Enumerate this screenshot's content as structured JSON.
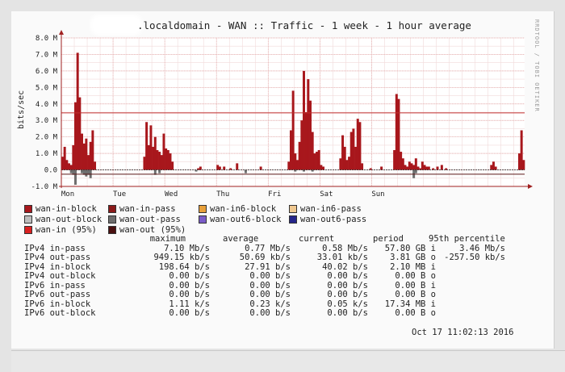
{
  "graph": {
    "title": ".localdomain - WAN :: Traffic - 1 week - 1 hour average",
    "credit": "RRDTOOL / TOBI OETIKER",
    "timestamp": "Oct 17 11:02:13 2016"
  },
  "colors": {
    "background": "#fafafa",
    "grid": "#e8b4b4",
    "in_block": "#a8171c",
    "percentile_line": "#c03030",
    "axis": "#a02020"
  },
  "chart_data": {
    "type": "bar",
    "title": ".localdomain - WAN :: Traffic - 1 week - 1 hour average",
    "ylabel": "bits/sec",
    "ylim": [
      -1000000,
      8000000
    ],
    "yticks": [
      {
        "value": 8000000,
        "label": "8.0 M"
      },
      {
        "value": 7000000,
        "label": "7.0 M"
      },
      {
        "value": 6000000,
        "label": "6.0 M"
      },
      {
        "value": 5000000,
        "label": "5.0 M"
      },
      {
        "value": 4000000,
        "label": "4.0 M"
      },
      {
        "value": 3000000,
        "label": "3.0 M"
      },
      {
        "value": 2000000,
        "label": "2.0 M"
      },
      {
        "value": 1000000,
        "label": "1.0 M"
      },
      {
        "value": 0,
        "label": "0.0"
      },
      {
        "value": -1000000,
        "label": "-1.0 M"
      }
    ],
    "xticks": [
      "Mon",
      "Tue",
      "Wed",
      "Thu",
      "Fri",
      "Sat",
      "Sun"
    ],
    "hours_total": 168,
    "percentile_lines": [
      {
        "name": "wan-in (95%)",
        "value": 3460000
      },
      {
        "name": "wan-out (95%)",
        "value": -257500
      }
    ],
    "series": [
      {
        "name": "wan-in-block",
        "points": [
          [
            0,
            0.8
          ],
          [
            1,
            1.4
          ],
          [
            2,
            0.6
          ],
          [
            3,
            0.4
          ],
          [
            4,
            0.3
          ],
          [
            5,
            1.5
          ],
          [
            6,
            4.1
          ],
          [
            7,
            7.1
          ],
          [
            8,
            4.4
          ],
          [
            9,
            2.2
          ],
          [
            10,
            1.6
          ],
          [
            11,
            1.9
          ],
          [
            12,
            0.9
          ],
          [
            13,
            1.7
          ],
          [
            14,
            2.4
          ],
          [
            15,
            0.5
          ],
          [
            38,
            0.8
          ],
          [
            39,
            2.9
          ],
          [
            40,
            1.5
          ],
          [
            41,
            2.7
          ],
          [
            42,
            1.4
          ],
          [
            43,
            2.0
          ],
          [
            44,
            1.2
          ],
          [
            45,
            1.1
          ],
          [
            46,
            0.9
          ],
          [
            47,
            2.2
          ],
          [
            48,
            1.3
          ],
          [
            49,
            1.2
          ],
          [
            50,
            1.0
          ],
          [
            51,
            0.5
          ],
          [
            63,
            0.1
          ],
          [
            64,
            0.2
          ],
          [
            72,
            0.3
          ],
          [
            73,
            0.2
          ],
          [
            75,
            0.2
          ],
          [
            78,
            0.1
          ],
          [
            81,
            0.4
          ],
          [
            92,
            0.2
          ],
          [
            105,
            0.5
          ],
          [
            106,
            2.4
          ],
          [
            107,
            4.8
          ],
          [
            108,
            1.0
          ],
          [
            109,
            0.6
          ],
          [
            110,
            1.7
          ],
          [
            111,
            3.0
          ],
          [
            112,
            6.0
          ],
          [
            113,
            3.5
          ],
          [
            114,
            5.5
          ],
          [
            115,
            4.2
          ],
          [
            116,
            2.3
          ],
          [
            117,
            1.0
          ],
          [
            118,
            1.1
          ],
          [
            119,
            1.2
          ],
          [
            120,
            0.3
          ],
          [
            121,
            0.2
          ],
          [
            129,
            0.7
          ],
          [
            130,
            2.1
          ],
          [
            131,
            1.4
          ],
          [
            132,
            0.6
          ],
          [
            133,
            0.8
          ],
          [
            134,
            2.3
          ],
          [
            135,
            2.5
          ],
          [
            136,
            1.4
          ],
          [
            137,
            3.1
          ],
          [
            138,
            2.9
          ],
          [
            139,
            0.4
          ],
          [
            143,
            0.1
          ],
          [
            148,
            0.2
          ],
          [
            154,
            1.2
          ],
          [
            155,
            4.6
          ],
          [
            156,
            4.3
          ],
          [
            157,
            1.1
          ],
          [
            158,
            0.7
          ],
          [
            159,
            0.3
          ],
          [
            160,
            0.2
          ],
          [
            161,
            0.5
          ],
          [
            162,
            0.4
          ],
          [
            163,
            0.3
          ],
          [
            164,
            0.7
          ],
          [
            165,
            0.2
          ],
          [
            166,
            0.1
          ],
          [
            167,
            0.5
          ],
          [
            168,
            0.3
          ],
          [
            169,
            0.2
          ],
          [
            170,
            0.2
          ],
          [
            172,
            0.1
          ],
          [
            174,
            0.2
          ],
          [
            176,
            0.3
          ],
          [
            178,
            0.1
          ],
          [
            199,
            0.3
          ],
          [
            200,
            0.5
          ],
          [
            201,
            0.2
          ],
          [
            212,
            1.0
          ],
          [
            213,
            2.4
          ],
          [
            214,
            0.6
          ]
        ]
      },
      {
        "name": "wan-out-pass",
        "points": [
          [
            4,
            -0.2
          ],
          [
            5,
            -0.3
          ],
          [
            6,
            -0.9
          ],
          [
            9,
            -0.2
          ],
          [
            10,
            -0.3
          ],
          [
            11,
            -0.4
          ],
          [
            12,
            -0.3
          ],
          [
            13,
            -0.5
          ],
          [
            43,
            -0.3
          ],
          [
            45,
            -0.2
          ],
          [
            62,
            -0.1
          ],
          [
            85,
            -0.2
          ],
          [
            108,
            -0.1
          ],
          [
            112,
            -0.1
          ],
          [
            116,
            -0.1
          ],
          [
            163,
            -0.5
          ],
          [
            164,
            -0.2
          ]
        ]
      }
    ],
    "hour_scale": 215
  },
  "legend": [
    {
      "label": "wan-in-block",
      "color": "#a8171c"
    },
    {
      "label": "wan-in-pass",
      "color": "#8b1a1a"
    },
    {
      "label": "wan-in6-block",
      "color": "#e8a03a"
    },
    {
      "label": "wan-in6-pass",
      "color": "#f0c890"
    },
    {
      "label": "wan-out-block",
      "color": "#bdbdbd"
    },
    {
      "label": "wan-out-pass",
      "color": "#6e6e6e"
    },
    {
      "label": "wan-out6-block",
      "color": "#7a5cc8"
    },
    {
      "label": "wan-out6-pass",
      "color": "#25258a"
    },
    {
      "label": "wan-in (95%)",
      "color": "#d92020"
    },
    {
      "label": "wan-out (95%)",
      "color": "#4a1010"
    }
  ],
  "stats": {
    "headers": [
      "maximum",
      "average",
      "current",
      "period",
      "95th percentile"
    ],
    "rows": [
      {
        "label": "IPv4 in-pass",
        "maximum": "7.10 Mb/s",
        "average": "0.77 Mb/s",
        "current": "0.58 Mb/s",
        "period": "57.80 GB i",
        "percentile": "3.46 Mb/s"
      },
      {
        "label": "IPv4 out-pass",
        "maximum": "949.15 kb/s",
        "average": "50.69 kb/s",
        "current": "33.01 kb/s",
        "period": "3.81 GB o",
        "percentile": "-257.50 kb/s"
      },
      {
        "label": "IPv4 in-block",
        "maximum": "198.64 b/s",
        "average": "27.91 b/s",
        "current": "40.02 b/s",
        "period": "2.10 MB i",
        "percentile": ""
      },
      {
        "label": "IPv4 out-block",
        "maximum": "0.00 b/s",
        "average": "0.00 b/s",
        "current": "0.00 b/s",
        "period": "0.00 B o",
        "percentile": ""
      },
      {
        "label": "IPv6 in-pass",
        "maximum": "0.00 b/s",
        "average": "0.00 b/s",
        "current": "0.00 b/s",
        "period": "0.00 B i",
        "percentile": ""
      },
      {
        "label": "IPv6 out-pass",
        "maximum": "0.00 b/s",
        "average": "0.00 b/s",
        "current": "0.00 b/s",
        "period": "0.00 B o",
        "percentile": ""
      },
      {
        "label": "IPv6 in-block",
        "maximum": "1.11 k/s",
        "average": "0.23 k/s",
        "current": "0.05 k/s",
        "period": "17.34 MB i",
        "percentile": ""
      },
      {
        "label": "IPv6 out-block",
        "maximum": "0.00 b/s",
        "average": "0.00 b/s",
        "current": "0.00 b/s",
        "period": "0.00 B o",
        "percentile": ""
      }
    ]
  }
}
